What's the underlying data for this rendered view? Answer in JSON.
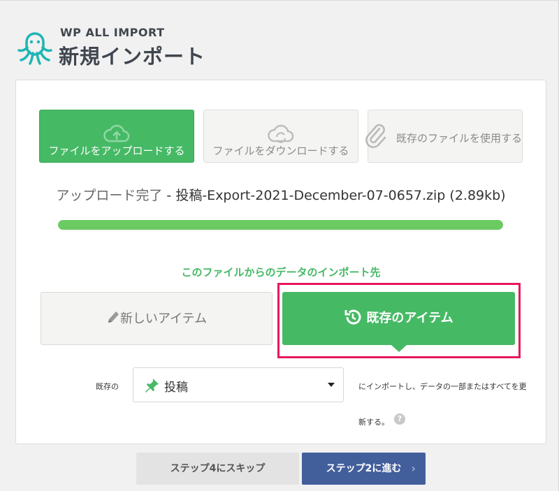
{
  "header": {
    "brand": "WP ALL IMPORT",
    "title": "新規インポート"
  },
  "source_buttons": {
    "upload_label": "ファイルをアップロードする",
    "download_label": "ファイルをダウンロードする",
    "existing_label": "既存のファイルを使用する"
  },
  "upload": {
    "status": "アップロード完了",
    "separator": " - ",
    "filename": "投稿-Export-2021-December-07-0657.zip",
    "size": "(2.89kb)",
    "progress_percent": 100
  },
  "import_to": {
    "heading": "このファイルからのデータのインポート先",
    "new_items_label": "新しいアイテム",
    "existing_items_label": "既存のアイテム"
  },
  "existing": {
    "prefix_label": "既存の",
    "selected_post_type": "投稿",
    "description_line1": "にインポートし、データの一部またはすべてを更",
    "description_line2": "新する。",
    "help_symbol": "?"
  },
  "footer": {
    "skip_label": "ステップ4にスキップ",
    "next_label": "ステップ2に進む",
    "next_chevron": "›"
  },
  "colors": {
    "accent_green": "#46b965",
    "progress_green": "#6bcb62",
    "primary_blue": "#425f9c",
    "highlight_red": "#e8175d",
    "logo_teal": "#1fb5b3"
  },
  "icons": [
    "octopus-logo-icon",
    "cloud-upload-icon",
    "cloud-sync-icon",
    "paperclip-icon",
    "pencil-icon",
    "history-clock-icon",
    "pushpin-icon",
    "caret-down-icon",
    "help-icon"
  ]
}
